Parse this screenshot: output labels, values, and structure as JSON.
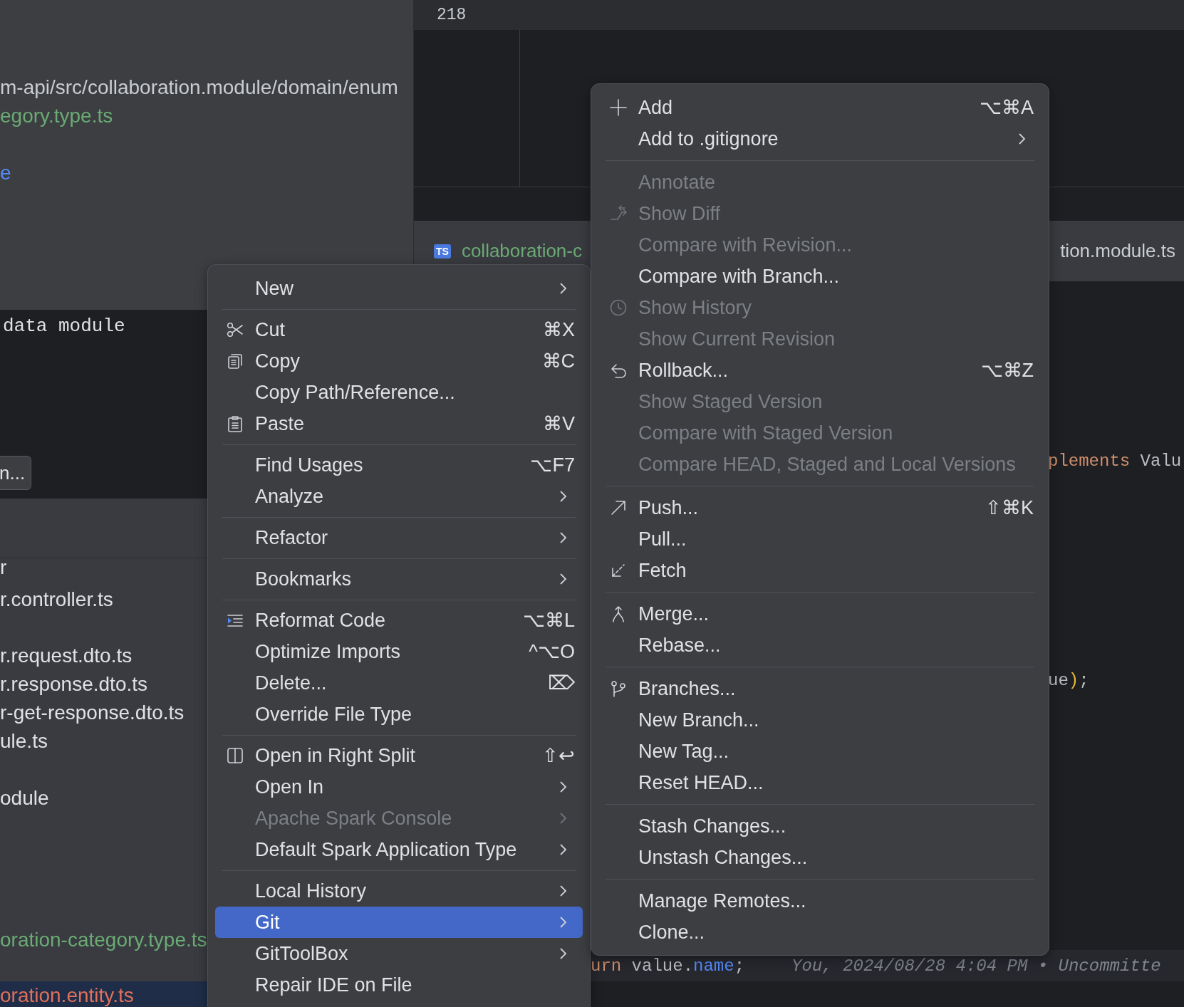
{
  "project_panel": {
    "path": "m-api/src/collaboration.module/domain/enum",
    "file_link": "egory.type.ts",
    "link_fragment": "e",
    "terminal_text": "data module",
    "terminal_button": "n...",
    "files": [
      {
        "name": "r",
        "color": "#dfe1e5",
        "selected": false
      },
      {
        "name": "r.controller.ts",
        "color": "#dfe1e5",
        "selected": false
      },
      {
        "name": "r.request.dto.ts",
        "color": "#dfe1e5",
        "selected": false
      },
      {
        "name": "r.response.dto.ts",
        "color": "#dfe1e5",
        "selected": false
      },
      {
        "name": "r-get-response.dto.ts",
        "color": "#dfe1e5",
        "selected": false
      },
      {
        "name": "ule.ts",
        "color": "#dfe1e5",
        "selected": false
      },
      {
        "name": "odule",
        "color": "#dfe1e5",
        "selected": false
      },
      {
        "name": "oration-category.type.ts",
        "color": "#6aab73",
        "selected": false
      },
      {
        "name": "oration.entity.ts",
        "color": "#e0705a",
        "selected": true
      }
    ]
  },
  "editor": {
    "line_number": "218",
    "tabs": [
      {
        "badge": "TS",
        "label": "collaboration-c",
        "color": "#6aab73"
      },
      {
        "label": "tion.module.ts",
        "color": "#c9ccd1"
      }
    ],
    "code_lines": [
      {
        "current": false,
        "tokens": [
          {
            "text": "plements",
            "kind": "keyword"
          },
          {
            "text": " Valu",
            "kind": "plain"
          }
        ]
      },
      {
        "current": false,
        "tokens": [
          {
            "text": "ue",
            "kind": "plain"
          },
          {
            "text": ")",
            "kind": "paren"
          },
          {
            "text": ";",
            "kind": "plain"
          }
        ]
      },
      {
        "current": true,
        "tokens": [
          {
            "text": "urn",
            "kind": "keyword"
          },
          {
            "text": " value.",
            "kind": "plain"
          },
          {
            "text": "name",
            "kind": "field"
          },
          {
            "text": ";",
            "kind": "plain"
          }
        ],
        "annotation": "You, 2024/08/28 4:04 PM • Uncommitte"
      }
    ]
  },
  "context_menu": {
    "groups": [
      {
        "items": [
          {
            "kind": "text",
            "label": "New",
            "submenu": true,
            "disabled": false,
            "selected": false
          }
        ]
      },
      {
        "items": [
          {
            "kind": "cut",
            "label": "Cut",
            "shortcut": "⌘X",
            "disabled": false,
            "selected": false
          },
          {
            "kind": "copy",
            "label": "Copy",
            "shortcut": "⌘C",
            "disabled": false,
            "selected": false
          },
          {
            "kind": "text",
            "label": "Copy Path/Reference...",
            "disabled": false,
            "selected": false
          },
          {
            "kind": "paste",
            "label": "Paste",
            "shortcut": "⌘V",
            "disabled": false,
            "selected": false
          }
        ]
      },
      {
        "items": [
          {
            "kind": "text",
            "label": "Find Usages",
            "shortcut": "⌥F7",
            "disabled": false,
            "selected": false
          },
          {
            "kind": "text",
            "label": "Analyze",
            "submenu": true,
            "disabled": false,
            "selected": false
          }
        ]
      },
      {
        "items": [
          {
            "kind": "text",
            "label": "Refactor",
            "submenu": true,
            "disabled": false,
            "selected": false
          }
        ]
      },
      {
        "items": [
          {
            "kind": "text",
            "label": "Bookmarks",
            "submenu": true,
            "disabled": false,
            "selected": false
          }
        ]
      },
      {
        "items": [
          {
            "kind": "reformat",
            "label": "Reformat Code",
            "shortcut": "⌥⌘L",
            "disabled": false,
            "selected": false
          },
          {
            "kind": "text",
            "label": "Optimize Imports",
            "shortcut": "^⌥O",
            "disabled": false,
            "selected": false
          },
          {
            "kind": "text",
            "label": "Delete...",
            "shortcut": "⌦",
            "disabled": false,
            "selected": false
          },
          {
            "kind": "text",
            "label": "Override File Type",
            "disabled": false,
            "selected": false
          }
        ]
      },
      {
        "items": [
          {
            "kind": "split",
            "label": "Open in Right Split",
            "shortcut": "⇧↩",
            "disabled": false,
            "selected": false
          },
          {
            "kind": "text",
            "label": "Open In",
            "submenu": true,
            "disabled": false,
            "selected": false
          },
          {
            "kind": "text",
            "label": "Apache Spark Console",
            "submenu": true,
            "disabled": true,
            "selected": false
          },
          {
            "kind": "text",
            "label": "Default Spark Application Type",
            "submenu": true,
            "disabled": false,
            "selected": false
          }
        ]
      },
      {
        "items": [
          {
            "kind": "text",
            "label": "Local History",
            "submenu": true,
            "disabled": false,
            "selected": false
          },
          {
            "kind": "text",
            "label": "Git",
            "submenu": true,
            "disabled": false,
            "selected": true
          },
          {
            "kind": "text",
            "label": "GitToolBox",
            "submenu": true,
            "disabled": false,
            "selected": false
          },
          {
            "kind": "text",
            "label": "Repair IDE on File",
            "disabled": false,
            "selected": false
          }
        ]
      }
    ]
  },
  "git_submenu": {
    "groups": [
      {
        "items": [
          {
            "kind": "add",
            "label": "Add",
            "shortcut": "⌥⌘A",
            "disabled": false,
            "selected": false
          },
          {
            "kind": "text",
            "label": "Add to .gitignore",
            "submenu": true,
            "disabled": false,
            "selected": false
          }
        ]
      },
      {
        "items": [
          {
            "kind": "text",
            "label": "Annotate",
            "disabled": true,
            "selected": false
          },
          {
            "kind": "diff",
            "label": "Show Diff",
            "disabled": true,
            "selected": false
          },
          {
            "kind": "text",
            "label": "Compare with Revision...",
            "disabled": true,
            "selected": false
          },
          {
            "kind": "text",
            "label": "Compare with Branch...",
            "disabled": false,
            "selected": false
          },
          {
            "kind": "history",
            "label": "Show History",
            "disabled": true,
            "selected": false
          },
          {
            "kind": "text",
            "label": "Show Current Revision",
            "disabled": true,
            "selected": false
          },
          {
            "kind": "rollback",
            "label": "Rollback...",
            "shortcut": "⌥⌘Z",
            "disabled": false,
            "selected": false
          },
          {
            "kind": "text",
            "label": "Show Staged Version",
            "disabled": true,
            "selected": false
          },
          {
            "kind": "text",
            "label": "Compare with Staged Version",
            "disabled": true,
            "selected": false
          },
          {
            "kind": "text",
            "label": "Compare HEAD, Staged and Local Versions",
            "disabled": true,
            "selected": false
          }
        ]
      },
      {
        "items": [
          {
            "kind": "push",
            "label": "Push...",
            "shortcut": "⇧⌘K",
            "disabled": false,
            "selected": false
          },
          {
            "kind": "text",
            "label": "Pull...",
            "disabled": false,
            "selected": false
          },
          {
            "kind": "fetch",
            "label": "Fetch",
            "disabled": false,
            "selected": false
          }
        ]
      },
      {
        "items": [
          {
            "kind": "merge",
            "label": "Merge...",
            "disabled": false,
            "selected": false
          },
          {
            "kind": "text",
            "label": "Rebase...",
            "disabled": false,
            "selected": false
          }
        ]
      },
      {
        "items": [
          {
            "kind": "branches",
            "label": "Branches...",
            "disabled": false,
            "selected": false
          },
          {
            "kind": "text",
            "label": "New Branch...",
            "disabled": false,
            "selected": false
          },
          {
            "kind": "text",
            "label": "New Tag...",
            "disabled": false,
            "selected": false
          },
          {
            "kind": "text",
            "label": "Reset HEAD...",
            "disabled": false,
            "selected": false
          }
        ]
      },
      {
        "items": [
          {
            "kind": "text",
            "label": "Stash Changes...",
            "disabled": false,
            "selected": false
          },
          {
            "kind": "text",
            "label": "Unstash Changes...",
            "disabled": false,
            "selected": false
          }
        ]
      },
      {
        "items": [
          {
            "kind": "text",
            "label": "Manage Remotes...",
            "disabled": false,
            "selected": false
          },
          {
            "kind": "text",
            "label": "Clone...",
            "disabled": false,
            "selected": false
          }
        ]
      }
    ]
  }
}
